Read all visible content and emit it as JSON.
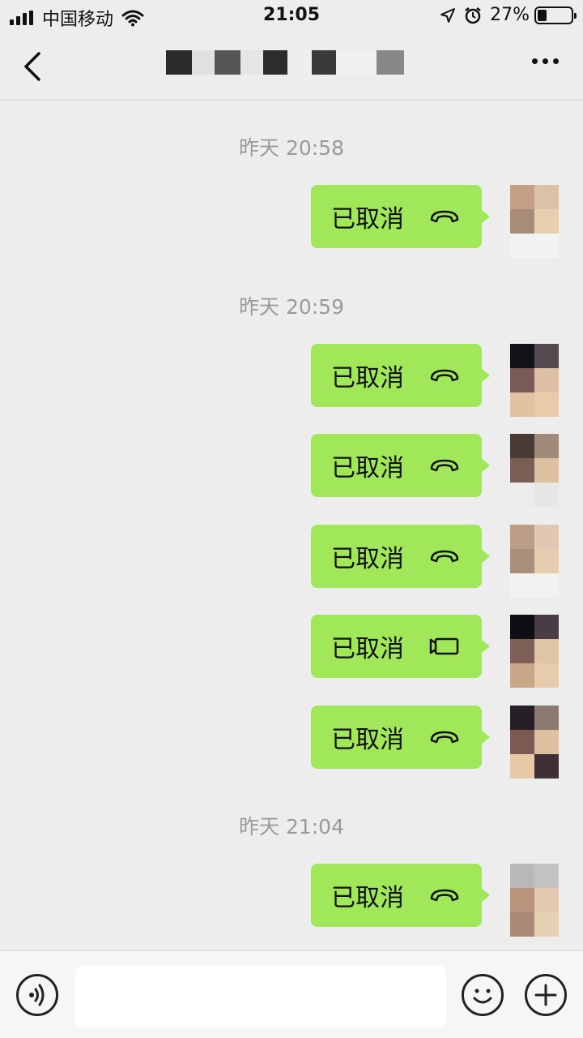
{
  "status_bar": {
    "carrier": "中国移动",
    "time": "21:05",
    "battery_percent_text": "27%",
    "battery_level": 0.27
  },
  "nav": {
    "title_blocks": [
      "#2a2a2a",
      "#e0e0e0",
      "#555555",
      "#e6e6e6",
      "#2c2c2c",
      "#eeeeee",
      "#3a3a3a",
      "#f0f0f0",
      "#888888"
    ]
  },
  "colors": {
    "bubble": "#a0e75a",
    "background": "#ededed",
    "timestamp": "#9a9a9a"
  },
  "chat": {
    "groups": [
      {
        "timestamp": "昨天 20:58",
        "messages": [
          {
            "text": "已取消",
            "icon": "phone-icon",
            "avatar": [
              "#c4a086",
              "#dcc0a8",
              "#a88c78",
              "#e8cfb0",
              "#f2f2f2",
              "#f2f2f2"
            ]
          }
        ]
      },
      {
        "timestamp": "昨天 20:59",
        "messages": [
          {
            "text": "已取消",
            "icon": "phone-icon",
            "avatar": [
              "#111116",
              "#564a50",
              "#7a5a54",
              "#dcbfa4",
              "#e0c4a2",
              "#e8cbaa"
            ]
          },
          {
            "text": "已取消",
            "icon": "phone-icon",
            "avatar": [
              "#4a3a36",
              "#a08a7a",
              "#7a5e54",
              "#dcc0a0",
              "#ececec",
              "#e6e6e6"
            ]
          },
          {
            "text": "已取消",
            "icon": "phone-icon",
            "avatar": [
              "#bc9e86",
              "#e2c8b2",
              "#a8907c",
              "#e6cdb0",
              "#f2f2f2",
              "#f2f2f2"
            ]
          },
          {
            "text": "已取消",
            "icon": "video-icon",
            "avatar": [
              "#0e0e14",
              "#4a3c46",
              "#7e6058",
              "#e0c4a6",
              "#c8a888",
              "#e6ccac"
            ]
          },
          {
            "text": "已取消",
            "icon": "phone-icon",
            "avatar": [
              "#262026",
              "#8c7a70",
              "#7a5a52",
              "#dcc0a0",
              "#e6caa6",
              "#3e3036"
            ]
          }
        ]
      },
      {
        "timestamp": "昨天 21:04",
        "messages": [
          {
            "text": "已取消",
            "icon": "phone-icon",
            "avatar": [
              "#b8b8b8",
              "#c2c2c2",
              "#b8947a",
              "#e4cab0",
              "#a88a76",
              "#e8d0b4"
            ]
          }
        ]
      }
    ]
  },
  "input": {
    "value": ""
  }
}
